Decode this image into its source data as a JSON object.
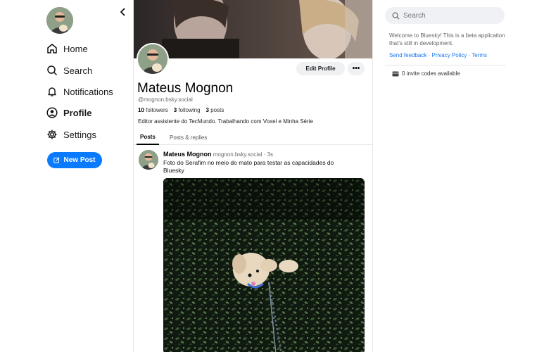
{
  "nav": {
    "items": [
      {
        "label": "Home",
        "icon": "home-icon"
      },
      {
        "label": "Search",
        "icon": "search-icon"
      },
      {
        "label": "Notifications",
        "icon": "bell-icon"
      },
      {
        "label": "Profile",
        "icon": "user-circle-icon"
      },
      {
        "label": "Settings",
        "icon": "gear-icon"
      }
    ],
    "new_post_label": "New Post"
  },
  "profile": {
    "display_name": "Mateus Mognon",
    "handle": "@mognon.bsky.social",
    "followers_count": "10",
    "followers_label": "followers",
    "following_count": "3",
    "following_label": "following",
    "posts_count": "3",
    "posts_label": "posts",
    "bio": "Editor assistente do TecMundo. Trabalhando com Voxel e Minha Série",
    "edit_label": "Edit Profile",
    "more_label": "•••"
  },
  "tabs": [
    {
      "label": "Posts",
      "active": true
    },
    {
      "label": "Posts & replies",
      "active": false
    }
  ],
  "post": {
    "author": "Mateus Mognon",
    "handle": "mognon.bsky.social",
    "time": "· 3s",
    "text": "Foto do Serafim no meio do mato para testar as capacidades do Bluesky"
  },
  "right": {
    "search_placeholder": "Search",
    "welcome": "Welcome to Bluesky! This is a beta application that's still in development.",
    "links": [
      "Send feedback",
      "Privacy Policy",
      "Terms"
    ],
    "link_sep": " · ",
    "invite": "0 invite codes available"
  },
  "colors": {
    "accent": "#0a7aff",
    "link": "#1877f2"
  }
}
